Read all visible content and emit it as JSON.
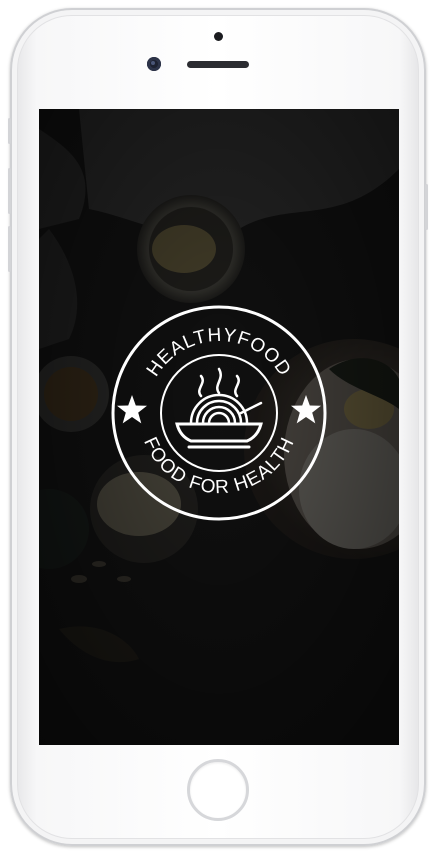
{
  "logo": {
    "title": "HEALTHYFOOD",
    "tagline": "FOOD FOR HEALTH"
  },
  "icons": {
    "badge_stars": "star-icon",
    "bowl": "bowl-icon",
    "steam": "steam-icon"
  },
  "colors": {
    "logo": "#ffffff",
    "background_dark": "#161616",
    "phone_body": "#ffffff"
  }
}
